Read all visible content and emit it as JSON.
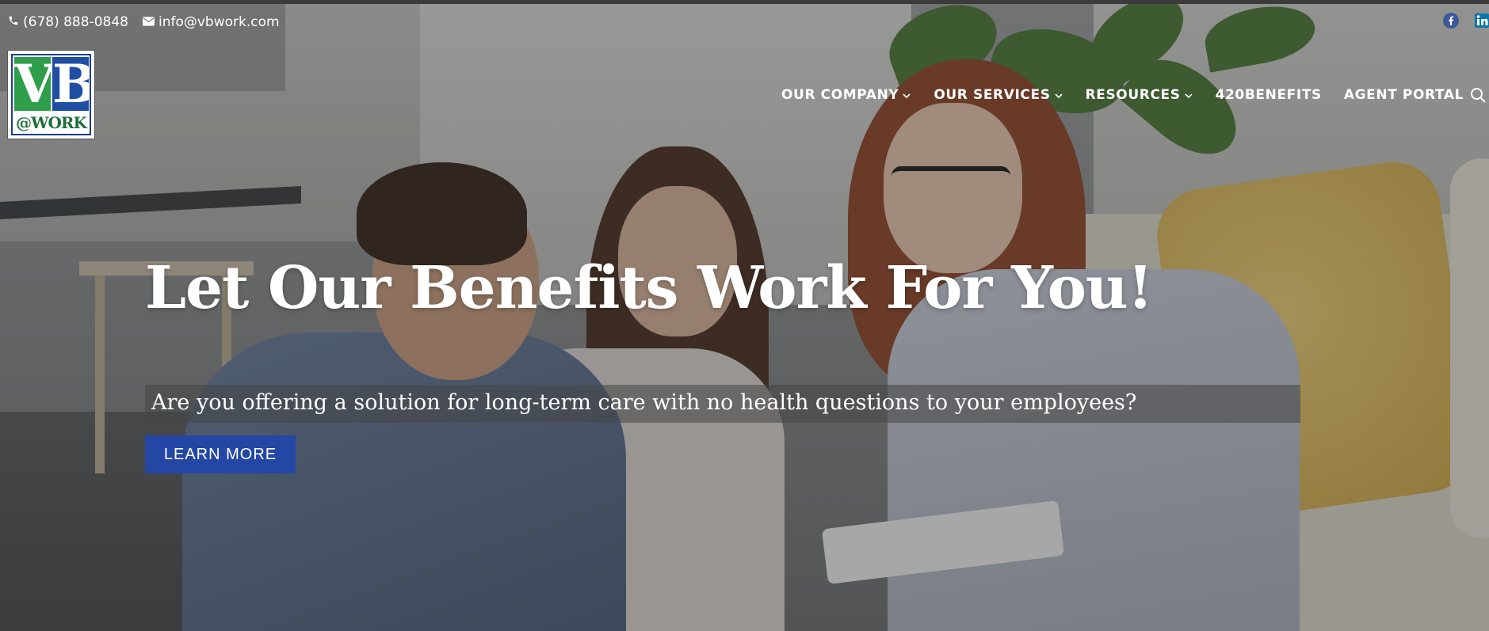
{
  "topbar": {
    "phone": "(678) 888-0848",
    "phone_icon": "phone-icon",
    "email": "info@vbwork.com",
    "email_icon": "envelope-icon"
  },
  "social": [
    {
      "name": "facebook-icon",
      "color": "#3b5998"
    },
    {
      "name": "linkedin-icon",
      "color": "#0e76a8"
    }
  ],
  "logo": {
    "letter_v": "V",
    "letter_b": "B",
    "tagline": "@WORK",
    "colors": {
      "green": "#2e9e4a",
      "blue": "#1f4ea3"
    }
  },
  "nav": {
    "items": [
      {
        "label": "OUR COMPANY",
        "has_dropdown": true
      },
      {
        "label": "OUR SERVICES",
        "has_dropdown": true
      },
      {
        "label": "RESOURCES",
        "has_dropdown": true
      },
      {
        "label": "420BENEFITS",
        "has_dropdown": false
      },
      {
        "label": "AGENT PORTAL",
        "has_dropdown": false
      }
    ],
    "search_icon": "search-icon"
  },
  "hero": {
    "headline": "Let Our Benefits Work For You!",
    "subtext": "Are you offering a solution for long-term care with no health questions to your employees?",
    "cta_label": "LEARN MORE",
    "cta_color": "#2446a4"
  }
}
